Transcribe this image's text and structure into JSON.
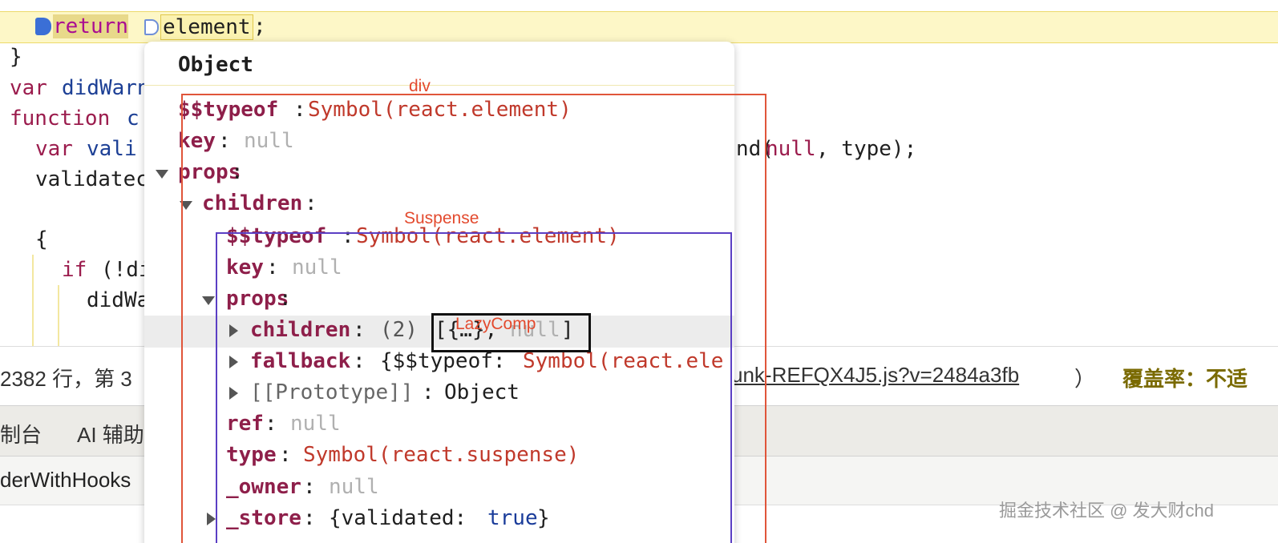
{
  "editor": {
    "lines": {
      "return_kw": "return",
      "return_var": "element",
      "return_semi": ";",
      "close_brace": "}",
      "var_kw": "var",
      "var_name": "didWarn",
      "function_kw": "function",
      "function_name": "c",
      "var2_kw": "var",
      "var2_name": "vali",
      "right_call_pre": "nd(",
      "right_call_null": "null",
      "right_call_post": ", type);",
      "validated": "validatec",
      "open_brace": "{",
      "if_kw": "if",
      "if_cond": "(!di",
      "did_wa": "didWa"
    }
  },
  "status_bar": {
    "position_text": "2382 行，第 3",
    "file_link": "unk-REFQX4J5.js?v=2484a3fb",
    "paren_close": "）",
    "coverage": "覆盖率：不适"
  },
  "console_tabs": {
    "tab1": "制台",
    "tab2": "AI 辅助"
  },
  "call_row": {
    "text": "derWithHooks"
  },
  "watermark": "掘金技术社区 @ 发大财chd",
  "popover": {
    "title": "Object",
    "rows": {
      "typeof_key": "$$typeof",
      "typeof_val": "Symbol(react.element)",
      "key_key": "key",
      "key_val": "null",
      "props_key": "props",
      "children_key": "children",
      "c_typeof_key": "$$typeof",
      "c_typeof_val": "Symbol(react.element)",
      "c_key_key": "key",
      "c_key_val": "null",
      "c_props_key": "props",
      "cc_children_key": "children",
      "cc_children_count": "(2)",
      "cc_children_open": "[{…}, ",
      "cc_children_null": "null",
      "cc_children_close": "]",
      "fallback_key": "fallback",
      "fallback_val_pre": "{$$typeof: ",
      "fallback_val_sym": "Symbol(react.ele",
      "prototype_key": "[[Prototype]]",
      "prototype_val": "Object",
      "ref_key": "ref",
      "ref_val": "null",
      "type_key": "type",
      "type_val": "Symbol(react.suspense)",
      "owner_key": "_owner",
      "owner_val": "null",
      "store_key": "_store",
      "store_val_pre": "{validated: ",
      "store_val_bool": "true",
      "store_val_post": "}"
    }
  },
  "annotations": {
    "div": "div",
    "suspense": "Suspense",
    "lazycomp": "LazyComp"
  },
  "colors": {
    "div_box": "#e0553a",
    "suspense_box": "#5b3fc4",
    "lazy_box": "#111111",
    "annotation_text": "#e34a2e",
    "highlight_line": "#fdf7c7"
  }
}
